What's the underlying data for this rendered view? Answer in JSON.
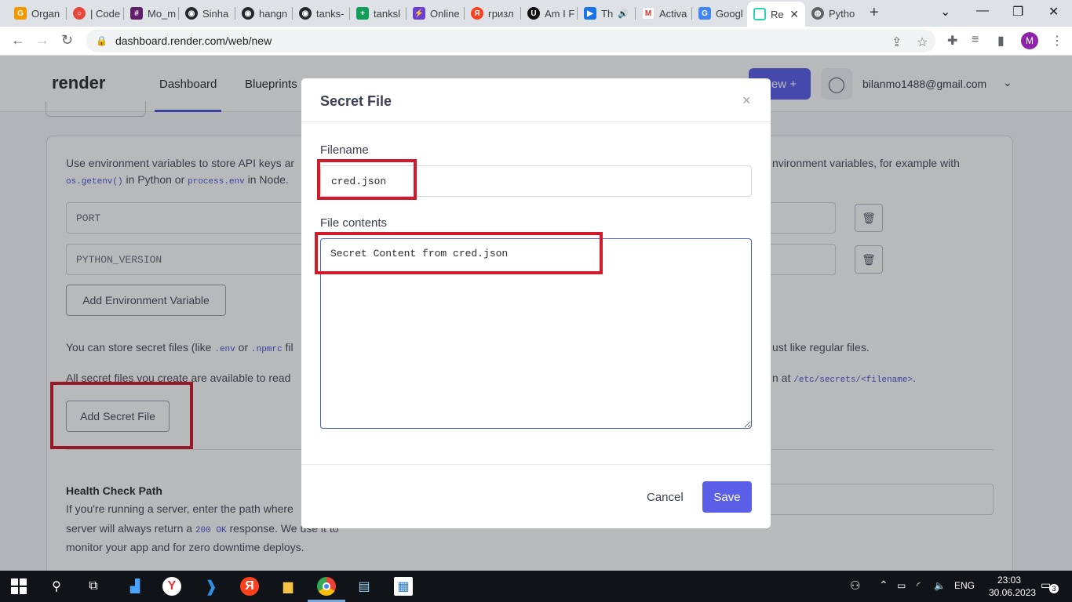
{
  "browser": {
    "tabs": [
      {
        "label": "Organ",
        "color": "#f29900"
      },
      {
        "label": "| Code",
        "color": "#e8453c"
      },
      {
        "label": "Mo_m",
        "color": "#611f69"
      },
      {
        "label": "Sinha",
        "color": "#24292f"
      },
      {
        "label": "hangn",
        "color": "#24292f"
      },
      {
        "label": "tanks-",
        "color": "#24292f"
      },
      {
        "label": "tanksl",
        "color": "#0f9d58"
      },
      {
        "label": "Online",
        "color": "#6b3fd4"
      },
      {
        "label": "гризл",
        "color": "#fc3f1d"
      },
      {
        "label": "Am I F",
        "color": "#111111"
      },
      {
        "label": "Th",
        "color": "#1a73e8"
      },
      {
        "label": "Activa",
        "color": "#d93025"
      },
      {
        "label": "Googl",
        "color": "#4285f4"
      },
      {
        "label": "Re",
        "color": "#2bd4b0"
      },
      {
        "label": "Pytho",
        "color": "#5f6368"
      }
    ],
    "url": "dashboard.render.com/web/new",
    "profile_initial": "M"
  },
  "header": {
    "logo": "render",
    "nav": [
      "Dashboard",
      "Blueprints"
    ],
    "new_label": "New +",
    "email": "bilanmo1488@gmail.com"
  },
  "env": {
    "intro_1": "Use environment variables to store API keys ar",
    "intro_1_right": "nvironment variables, for example with",
    "code_getenv": "os.getenv()",
    "text_in_python": "in Python or",
    "code_process_env": "process.env",
    "text_in_node": "in Node.",
    "keys": [
      "PORT",
      "PYTHON_VERSION"
    ],
    "add_label": "Add Environment Variable"
  },
  "secrets": {
    "line1_start": "You can store secret files (like",
    "code_env": ".env",
    "text_or": "or",
    "code_npmrc": ".npmrc",
    "line1_fil": "fil",
    "line1_right": "ust like regular files.",
    "line2_left": "All secret files you create are available to read",
    "line2_right": "n at",
    "code_path": "/etc/secrets/<filename>",
    "line2_end": ".",
    "add_label": "Add Secret File"
  },
  "health": {
    "title": "Health Check Path",
    "line1": "If you're running a server, enter the path where",
    "line2_start": "server will always return a",
    "code_200": "200 OK",
    "line2_end": "response. We use it to",
    "line3": "monitor your app and for zero downtime deploys."
  },
  "modal": {
    "title": "Secret File",
    "filename_label": "Filename",
    "filename_value": "cred.json",
    "contents_label": "File contents",
    "contents_value": "Secret Content from cred.json",
    "cancel_label": "Cancel",
    "save_label": "Save"
  },
  "taskbar": {
    "lang": "ENG",
    "time": "23:03",
    "date": "30.06.2023",
    "notifications": "3"
  }
}
